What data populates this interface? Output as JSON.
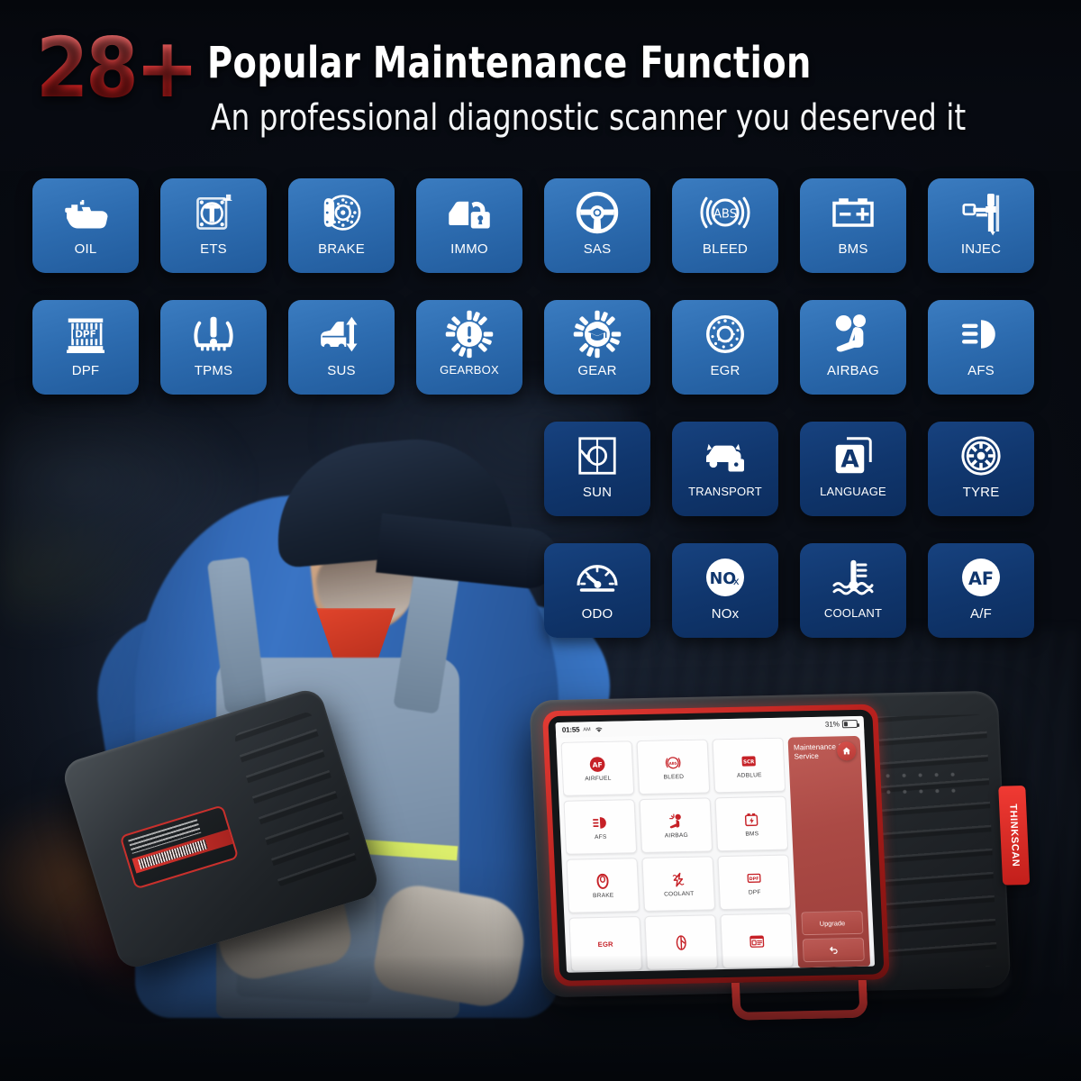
{
  "header": {
    "badge_number": "28+",
    "title": "Popular Maintenance Function",
    "subtitle": "An professional diagnostic scanner you deserved it",
    "badge_color": "#e33a3a",
    "title_color": "#ffffff"
  },
  "grid": {
    "tile_color_bright": "#2d6cb0",
    "tile_color_dark": "#10366d",
    "rows": [
      {
        "align": "left",
        "style": "bright",
        "tiles": [
          {
            "label": "OIL",
            "icon": "oil-can-icon"
          },
          {
            "label": "ETS",
            "icon": "throttle-body-icon"
          },
          {
            "label": "BRAKE",
            "icon": "brake-disc-icon"
          },
          {
            "label": "IMMO",
            "icon": "car-lock-icon"
          },
          {
            "label": "SAS",
            "icon": "steering-wheel-icon"
          },
          {
            "label": "BLEED",
            "icon": "abs-icon"
          },
          {
            "label": "BMS",
            "icon": "battery-icon"
          },
          {
            "label": "INJEC",
            "icon": "injector-icon"
          }
        ]
      },
      {
        "align": "left",
        "style": "bright",
        "tiles": [
          {
            "label": "DPF",
            "icon": "dpf-filter-icon"
          },
          {
            "label": "TPMS",
            "icon": "tpms-icon"
          },
          {
            "label": "SUS",
            "icon": "suspension-icon"
          },
          {
            "label": "GEARBOX",
            "icon": "gear-warning-icon"
          },
          {
            "label": "GEAR",
            "icon": "gear-learn-icon"
          },
          {
            "label": "EGR",
            "icon": "egr-valve-icon"
          },
          {
            "label": "AIRBAG",
            "icon": "airbag-seat-icon"
          },
          {
            "label": "AFS",
            "icon": "headlight-icon"
          }
        ]
      },
      {
        "align": "right",
        "style": "dark",
        "tiles": [
          {
            "label": "SUN",
            "icon": "sunroof-reset-icon"
          },
          {
            "label": "TRANSPORT",
            "icon": "transport-mode-icon"
          },
          {
            "label": "LANGUAGE",
            "icon": "language-icon"
          },
          {
            "label": "TYRE",
            "icon": "tyre-icon"
          }
        ]
      },
      {
        "align": "right",
        "style": "dark",
        "tiles": [
          {
            "label": "ODO",
            "icon": "odometer-icon"
          },
          {
            "label": "NOx",
            "icon": "nox-sensor-icon"
          },
          {
            "label": "COOLANT",
            "icon": "coolant-temp-icon"
          },
          {
            "label": "A/F",
            "icon": "air-fuel-icon"
          }
        ]
      }
    ]
  },
  "device": {
    "brand_tab": "THINKSCAN",
    "status_bar": {
      "time": "01:55",
      "am_pm": "AM",
      "wifi_icon": "wifi-icon",
      "battery_percent": "31%",
      "battery_level": 31
    },
    "side_panel": {
      "title": "Maintenance & Service",
      "home_icon": "home-icon",
      "upgrade_label": "Upgrade",
      "back_icon": "back-arrow-icon"
    },
    "functions": [
      {
        "label": "AIRFUEL",
        "icon": "af-badge-icon",
        "red_label": false
      },
      {
        "label": "BLEED",
        "icon": "abs-badge-icon",
        "red_label": false
      },
      {
        "label": "ADBLUE",
        "icon": "scr-badge-icon",
        "red_label": false
      },
      {
        "label": "AFS",
        "icon": "headlight-icon",
        "red_label": false
      },
      {
        "label": "AIRBAG",
        "icon": "airbag-icon",
        "red_label": false
      },
      {
        "label": "BMS",
        "icon": "battery-icon",
        "red_label": false
      },
      {
        "label": "BRAKE",
        "icon": "brake-icon",
        "red_label": false
      },
      {
        "label": "COOLANT",
        "icon": "coolant-icon",
        "red_label": false
      },
      {
        "label": "DPF",
        "icon": "dpf-icon",
        "red_label": false
      },
      {
        "label": "EGR",
        "icon": "egr-text-icon",
        "red_label": true
      },
      {
        "label": "",
        "icon": "injector-icon",
        "red_label": false
      },
      {
        "label": "",
        "icon": "service-reset-icon",
        "red_label": false
      }
    ]
  }
}
